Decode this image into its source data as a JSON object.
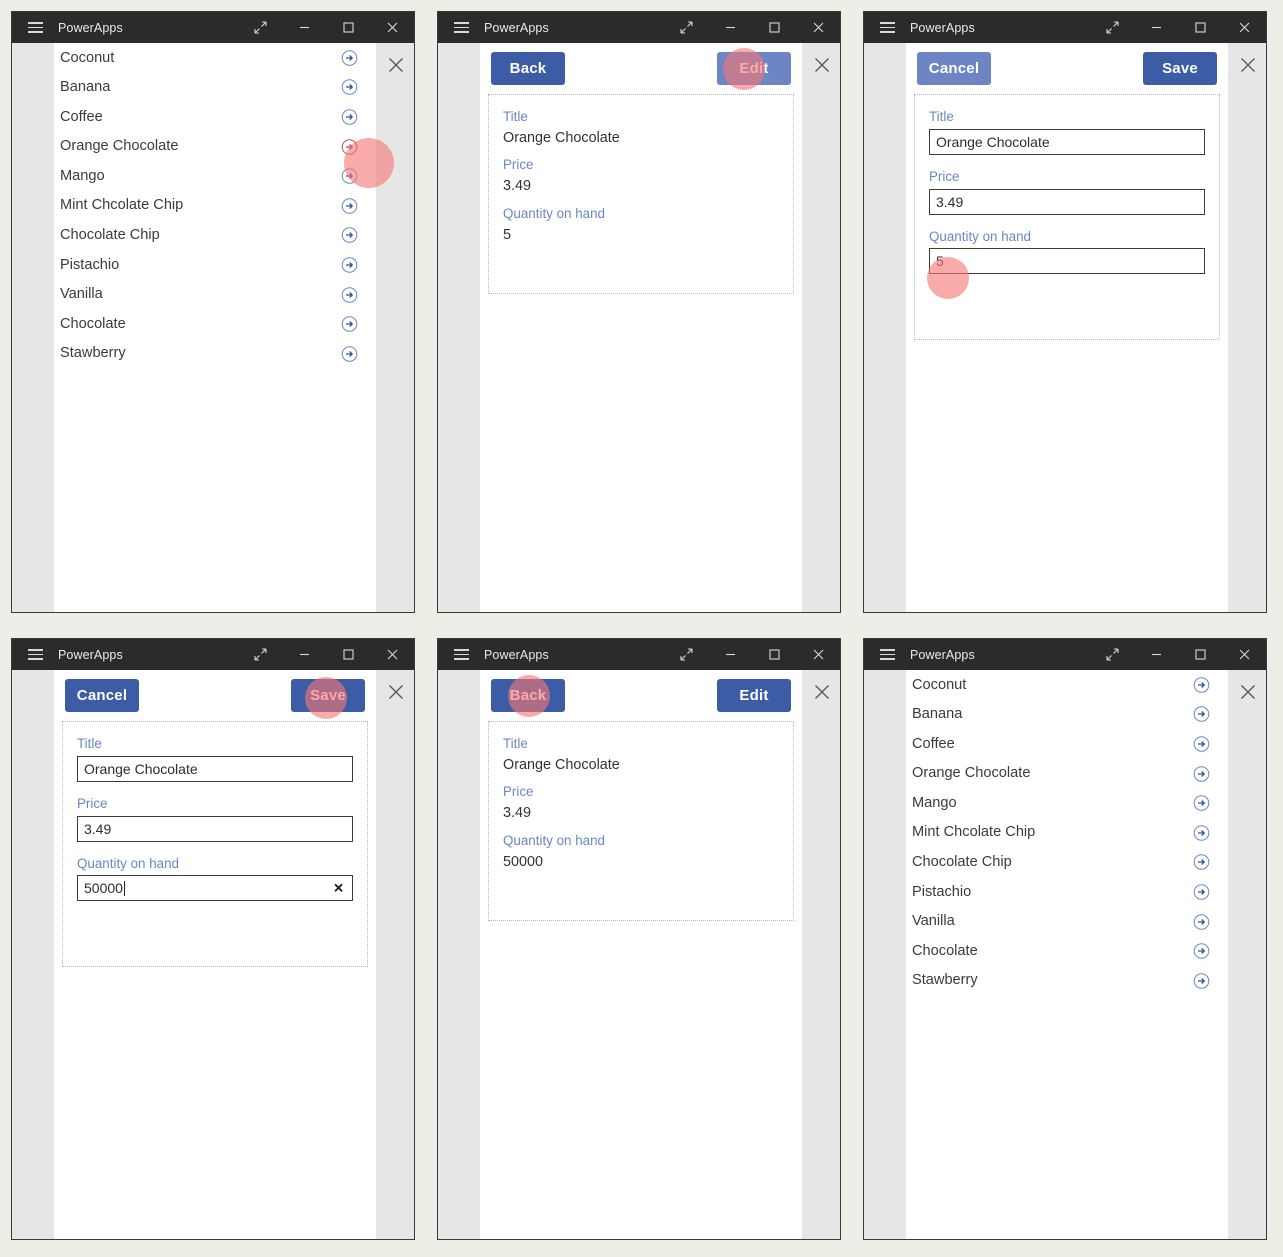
{
  "window": {
    "app_title": "PowerApps",
    "menu_icon": "hamburger-icon",
    "restore_icon": "expand-diagonal-icon",
    "minimize_icon": "minimize-icon",
    "maximize_icon": "maximize-icon",
    "close_icon": "close-icon",
    "panel_close_icon": "close-icon"
  },
  "colors": {
    "titlebar_bg": "#2b2b2b",
    "button_primary": "#3d5ca6",
    "button_hover": "#6d85c4",
    "label_blue": "#6b86c6",
    "arrow_blue": "#3d5ca6",
    "click_indicator": "#f47872",
    "page_bg": "#efeee6",
    "app_bg": "#e6e6e6"
  },
  "gallery": {
    "items": [
      {
        "label": "Coconut",
        "icon": "arrow-circle-right-icon"
      },
      {
        "label": "Banana",
        "icon": "arrow-circle-right-icon"
      },
      {
        "label": "Coffee",
        "icon": "arrow-circle-right-icon"
      },
      {
        "label": "Orange Chocolate",
        "icon": "arrow-circle-right-icon"
      },
      {
        "label": "Mango",
        "icon": "arrow-circle-right-icon"
      },
      {
        "label": "Mint Chcolate Chip",
        "icon": "arrow-circle-right-icon"
      },
      {
        "label": "Chocolate Chip",
        "icon": "arrow-circle-right-icon"
      },
      {
        "label": "Pistachio",
        "icon": "arrow-circle-right-icon"
      },
      {
        "label": "Vanilla",
        "icon": "arrow-circle-right-icon"
      },
      {
        "label": "Chocolate",
        "icon": "arrow-circle-right-icon"
      },
      {
        "label": "Stawberry",
        "icon": "arrow-circle-right-icon"
      }
    ]
  },
  "labels": {
    "title": "Title",
    "price": "Price",
    "quantity": "Quantity on hand"
  },
  "buttons": {
    "back": "Back",
    "edit": "Edit",
    "cancel": "Cancel",
    "save": "Save",
    "clear_icon": "clear-x-icon"
  },
  "panels": [
    {
      "id": "panel-1-gallery",
      "screen": "gallery",
      "note": "browse screen, arrow for Orange Chocolate is being clicked"
    },
    {
      "id": "panel-2-detail-before",
      "screen": "detail",
      "record": {
        "title": "Orange Chocolate",
        "price": "3.49",
        "quantity": "5"
      },
      "note": "detail screen, Edit button hovered and clicked"
    },
    {
      "id": "panel-3-edit-before",
      "screen": "edit",
      "record": {
        "title": "Orange Chocolate",
        "price": "3.49",
        "quantity": "5"
      },
      "note": "edit form, quantity field being clicked"
    },
    {
      "id": "panel-4-edit-typed",
      "screen": "edit",
      "record": {
        "title": "Orange Chocolate",
        "price": "3.49",
        "quantity": "50000"
      },
      "note": "quantity typed 50000, Save being clicked"
    },
    {
      "id": "panel-5-detail-after",
      "screen": "detail",
      "record": {
        "title": "Orange Chocolate",
        "price": "3.49",
        "quantity": "50000"
      },
      "note": "detail screen shows saved value, Back being clicked"
    },
    {
      "id": "panel-6-gallery-after",
      "screen": "gallery",
      "note": "back at the browse gallery"
    }
  ]
}
